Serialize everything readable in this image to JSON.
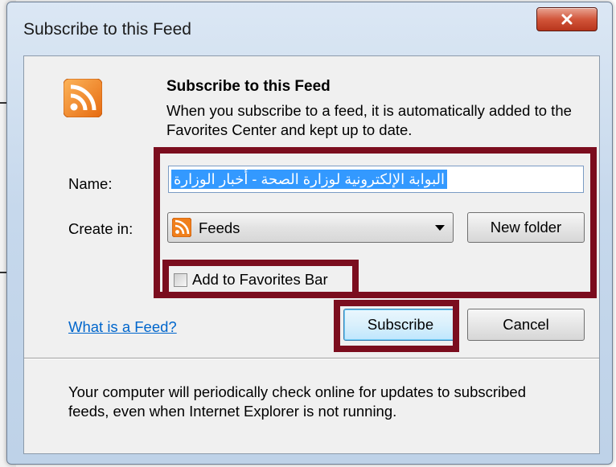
{
  "dialog": {
    "title": "Subscribe to this Feed",
    "close_label": "X"
  },
  "content": {
    "heading": "Subscribe to this Feed",
    "description": "When you subscribe to a feed, it is automatically added to the Favorites Center and kept up to date."
  },
  "form": {
    "name_label": "Name:",
    "name_value": "البوابة الإلكترونية لوزارة الصحة - أخبار الوزارة",
    "create_in_label": "Create in:",
    "create_in_value": "Feeds",
    "new_folder_label": "New folder",
    "add_to_favorites_label": "Add to Favorites Bar",
    "add_to_favorites_checked": false
  },
  "actions": {
    "help_link": "What is a Feed?",
    "subscribe_label": "Subscribe",
    "cancel_label": "Cancel"
  },
  "footer": {
    "text": "Your computer will periodically check online for updates to subscribed feeds, even when Internet Explorer is not running."
  },
  "colors": {
    "highlight": "#7b0d1e",
    "rss_orange": "#f07f1b",
    "link": "#0066cc",
    "selection": "#3399ff"
  },
  "icons": {
    "feed": "rss-icon",
    "close": "close-icon"
  }
}
